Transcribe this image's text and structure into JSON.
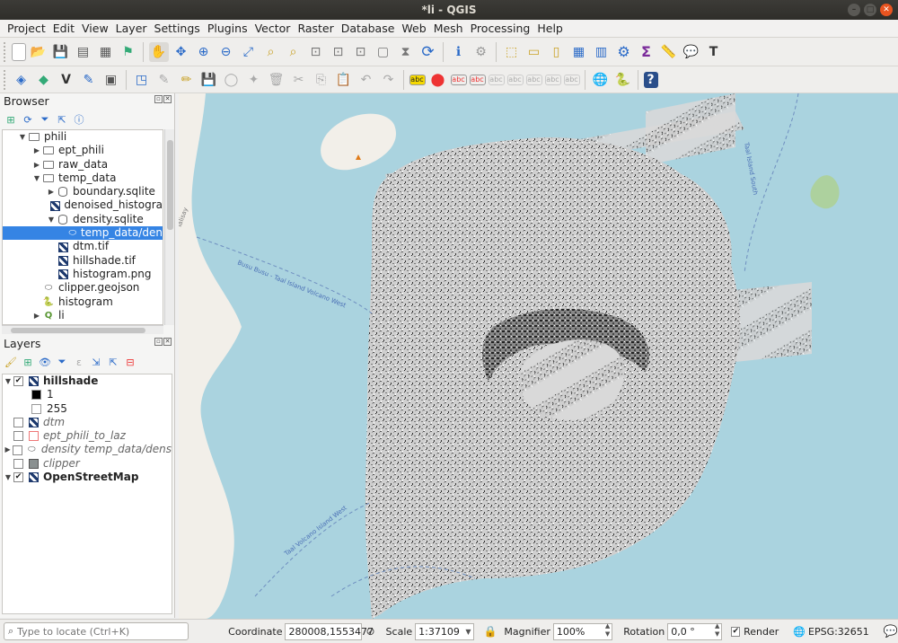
{
  "window": {
    "title": "*li - QGIS"
  },
  "menu": [
    "Project",
    "Edit",
    "View",
    "Layer",
    "Settings",
    "Plugins",
    "Vector",
    "Raster",
    "Database",
    "Web",
    "Mesh",
    "Processing",
    "Help"
  ],
  "browser": {
    "title": "Browser",
    "items": [
      {
        "label": "phili",
        "indent": 1,
        "arrow": "▼",
        "icon": "folder"
      },
      {
        "label": "ept_phili",
        "indent": 2,
        "arrow": "▶",
        "icon": "folder"
      },
      {
        "label": "raw_data",
        "indent": 2,
        "arrow": "▶",
        "icon": "folder"
      },
      {
        "label": "temp_data",
        "indent": 2,
        "arrow": "▼",
        "icon": "folder"
      },
      {
        "label": "boundary.sqlite",
        "indent": 3,
        "arrow": "▶",
        "icon": "db"
      },
      {
        "label": "denoised_histogra",
        "indent": 3,
        "arrow": "",
        "icon": "raster"
      },
      {
        "label": "density.sqlite",
        "indent": 3,
        "arrow": "▼",
        "icon": "db"
      },
      {
        "label": "temp_data/den",
        "indent": 4,
        "arrow": "",
        "icon": "polygon"
      },
      {
        "label": "dtm.tif",
        "indent": 3,
        "arrow": "",
        "icon": "raster"
      },
      {
        "label": "hillshade.tif",
        "indent": 3,
        "arrow": "",
        "icon": "raster"
      },
      {
        "label": "histogram.png",
        "indent": 3,
        "arrow": "",
        "icon": "raster"
      },
      {
        "label": "clipper.geojson",
        "indent": 2,
        "arrow": "",
        "icon": "polygon"
      },
      {
        "label": "histogram",
        "indent": 2,
        "arrow": "",
        "icon": "python"
      },
      {
        "label": "li",
        "indent": 2,
        "arrow": "▶",
        "icon": "qgis"
      }
    ]
  },
  "layers": {
    "title": "Layers",
    "items": [
      {
        "label": "hillshade",
        "checked": true,
        "style": "bold",
        "arrow": "▼"
      },
      {
        "label": "1",
        "sub": true,
        "swatch": "#000000"
      },
      {
        "label": "255",
        "sub": true,
        "swatch": "#ffffff"
      },
      {
        "label": "dtm",
        "checked": false,
        "style": "ital",
        "arrow": ""
      },
      {
        "label": "ept_phili_to_laz",
        "checked": false,
        "style": "ital",
        "arrow": ""
      },
      {
        "label": "density temp_data/dens",
        "checked": false,
        "style": "ital",
        "arrow": "▶"
      },
      {
        "label": "clipper",
        "checked": false,
        "style": "ital",
        "arrow": ""
      },
      {
        "label": "OpenStreetMap",
        "checked": true,
        "style": "bold",
        "arrow": "▼"
      }
    ]
  },
  "map": {
    "labels": [
      "Busu Busu - Taal Island Volcano West",
      "Taal Volcano Island West",
      "Taal Island South",
      "Talisay"
    ]
  },
  "status": {
    "locate_placeholder": "Type to locate (Ctrl+K)",
    "coordinate_label": "Coordinate",
    "coordinate": "280008,1553477",
    "scale_label": "Scale",
    "scale": "1:37109",
    "magnifier_label": "Magnifier",
    "magnifier": "100%",
    "rotation_label": "Rotation",
    "rotation": "0,0 °",
    "render_label": "Render",
    "epsg": "EPSG:32651"
  }
}
